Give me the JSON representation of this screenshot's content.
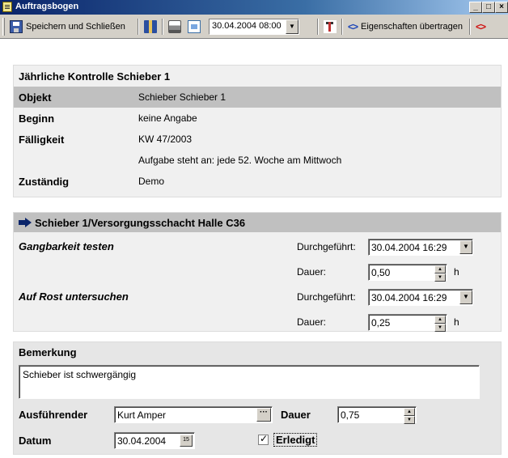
{
  "window": {
    "title": "Auftragsbogen",
    "buttons": [
      "_",
      "□",
      "×"
    ]
  },
  "toolbar": {
    "save_label": "Speichern und Schließen",
    "date_value": "30.04.2004 08:00",
    "transfer_label": "Eigenschaften übertragen"
  },
  "header": {
    "title": "Jährliche Kontrolle Schieber 1",
    "rows": [
      {
        "key": "Objekt",
        "value": "Schieber Schieber 1"
      },
      {
        "key": "Beginn",
        "value": "keine Angabe"
      },
      {
        "key": "Fälligkeit",
        "value": "KW 47/2003"
      },
      {
        "key": "",
        "value": "Aufgabe steht an: jede 52. Woche am Mittwoch"
      },
      {
        "key": "Zuständig",
        "value": "Demo"
      }
    ]
  },
  "object_section": {
    "title": "Schieber 1/Versorgungsschacht Halle C36",
    "tasks": [
      {
        "name": "Gangbarkeit testen",
        "done_label": "Durchgeführt:",
        "done_value": "30.04.2004 16:29",
        "duration_label": "Dauer:",
        "duration_value": "0,50",
        "unit": "h"
      },
      {
        "name": "Auf Rost untersuchen",
        "done_label": "Durchgeführt:",
        "done_value": "30.04.2004 16:29",
        "duration_label": "Dauer:",
        "duration_value": "0,25",
        "unit": "h"
      }
    ]
  },
  "remark_section": {
    "title": "Bemerkung",
    "remark_text": "Schieber ist schwergängig",
    "executor_label": "Ausführender",
    "executor_value": "Kurt Amper",
    "duration_label": "Dauer",
    "duration_value": "0,75",
    "date_label": "Datum",
    "date_value": "30.04.2004",
    "done_label": "Erledigt",
    "done_checked": true
  }
}
